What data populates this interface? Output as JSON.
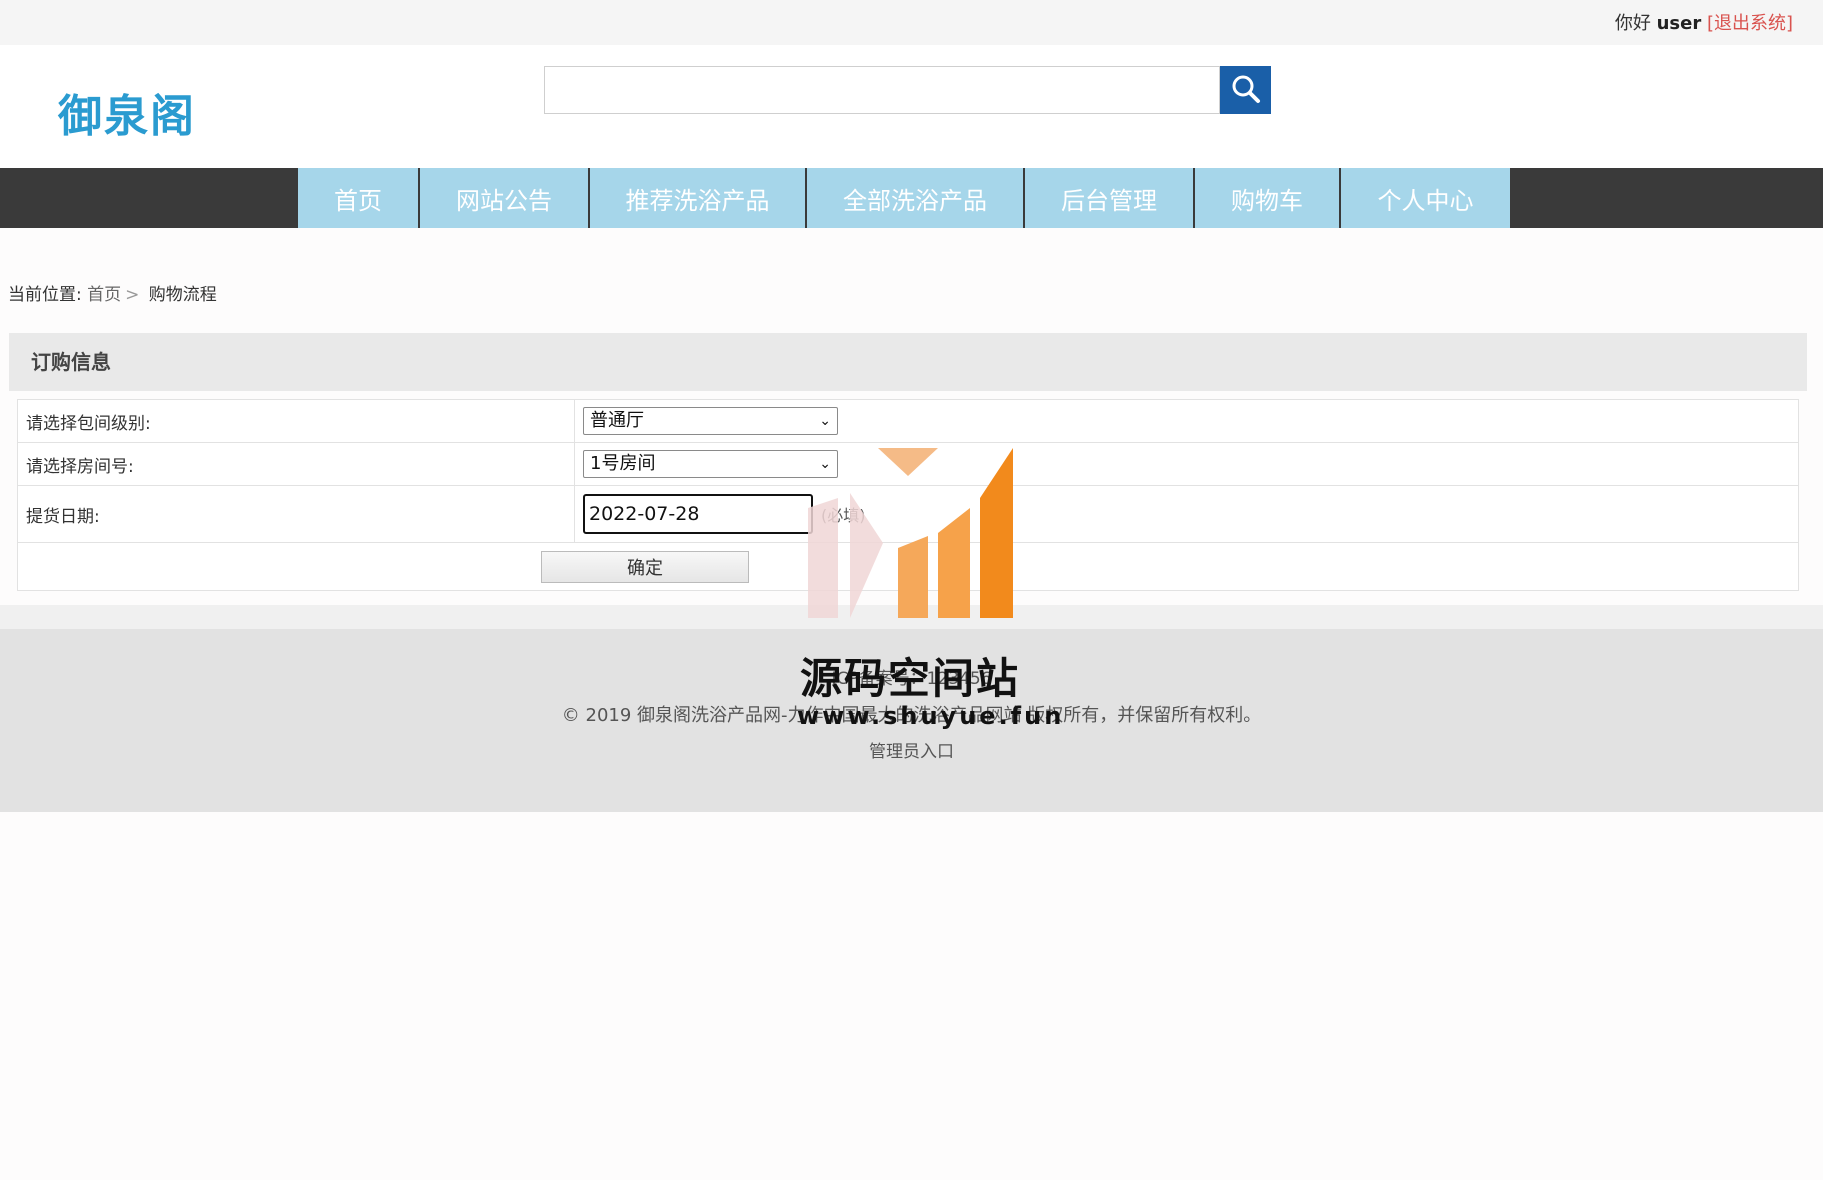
{
  "topbar": {
    "greeting": "你好",
    "username": "user",
    "logout": "[退出系统]"
  },
  "header": {
    "logo": "御泉阁",
    "search": {
      "value": "",
      "placeholder": ""
    }
  },
  "nav": {
    "items": [
      {
        "label": "首页"
      },
      {
        "label": "网站公告"
      },
      {
        "label": "推荐洗浴产品"
      },
      {
        "label": "全部洗浴产品"
      },
      {
        "label": "后台管理"
      },
      {
        "label": "购物车"
      },
      {
        "label": "个人中心"
      }
    ]
  },
  "breadcrumb": {
    "prefix": "当前位置:",
    "home": "首页",
    "separator": ">",
    "current": "购物流程"
  },
  "order": {
    "title": "订购信息",
    "room_level_label": "请选择包间级别:",
    "room_level_value": "普通厅",
    "room_no_label": "请选择房间号:",
    "room_no_value": "1号房间",
    "date_label": "提货日期:",
    "date_value": "2022-07-28",
    "required_note": "(必填)",
    "submit_label": "确定"
  },
  "footer": {
    "icp": "ICP备案号：123456",
    "copyright": "© 2019 御泉阁洗浴产品网-力作中国最大的洗浴产品网站 版权所有，并保留所有权利。",
    "admin_link": "管理员入口"
  },
  "watermark": {
    "title": "源码空间站",
    "url": "www.shuyue.fun"
  },
  "colors": {
    "nav_bg": "#a6d6ea",
    "nav_bar": "#3a3a3a",
    "search_btn": "#1a5fa8",
    "logo": "#2a9bd0",
    "logout": "#d9534f"
  }
}
